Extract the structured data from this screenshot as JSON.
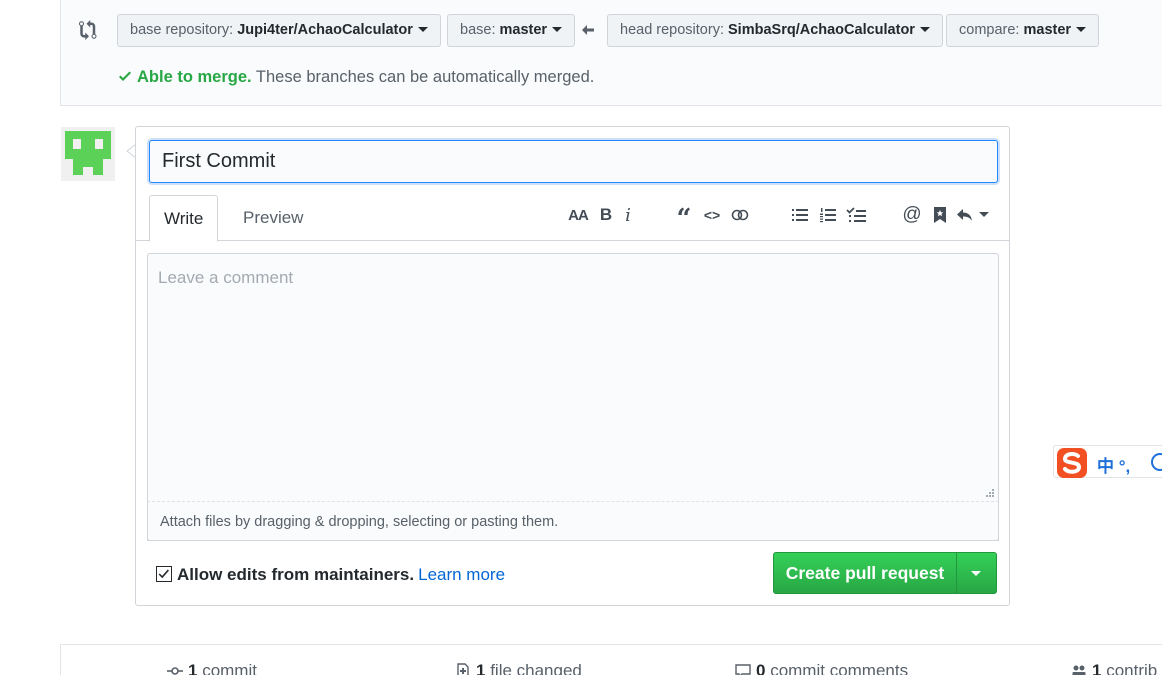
{
  "compare": {
    "base_repo_label": "base repository:",
    "base_repo_value": "Jupi4ter/AchaoCalculator",
    "base_label": "base:",
    "base_value": "master",
    "head_repo_label": "head repository:",
    "head_repo_value": "SimbaSrq/AchaoCalculator",
    "compare_label": "compare:",
    "compare_value": "master",
    "merge_ok": "Able to merge.",
    "merge_text": " These branches can be automatically merged."
  },
  "form": {
    "title_value": "First Commit",
    "tab_write": "Write",
    "tab_preview": "Preview",
    "toolbar": {
      "heading": "AA",
      "bold": "B",
      "italic": "i",
      "quote": "“",
      "code": "<>"
    },
    "comment_placeholder": "Leave a comment",
    "attach_text": "Attach files by dragging & dropping, selecting or pasting them.",
    "allow_edits_label": "Allow edits from maintainers.",
    "learn_more": "Learn more",
    "create_pr_label": "Create pull request"
  },
  "ime": {
    "text": "中 °,"
  },
  "summary": {
    "commits_count": "1",
    "commits_label": " commit",
    "files_count": "1",
    "files_label": " file changed",
    "comments_count": "0",
    "comments_label": " commit comments",
    "contrib_count": "1",
    "contrib_label": " contrib"
  },
  "colors": {
    "accent_green": "#28a745",
    "link_blue": "#0366d6",
    "focus_blue": "#2188ff"
  }
}
